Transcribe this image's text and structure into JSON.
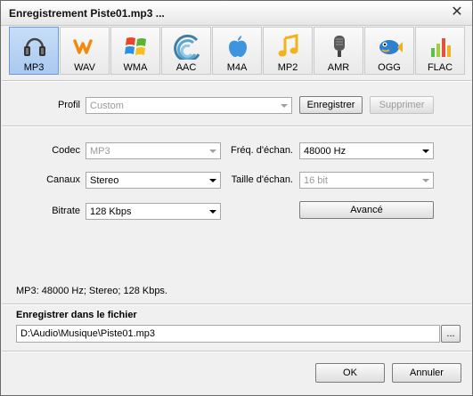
{
  "window": {
    "title": "Enregistrement Piste01.mp3 ...",
    "close_glyph": "✕"
  },
  "formats": [
    {
      "label": "MP3",
      "icon": "headphones-icon",
      "selected": true
    },
    {
      "label": "WAV",
      "icon": "wav-icon",
      "selected": false
    },
    {
      "label": "WMA",
      "icon": "windows-icon",
      "selected": false
    },
    {
      "label": "AAC",
      "icon": "aac-icon",
      "selected": false
    },
    {
      "label": "M4A",
      "icon": "apple-icon",
      "selected": false
    },
    {
      "label": "MP2",
      "icon": "music-note-icon",
      "selected": false
    },
    {
      "label": "AMR",
      "icon": "microphone-icon",
      "selected": false
    },
    {
      "label": "OGG",
      "icon": "fish-icon",
      "selected": false
    },
    {
      "label": "FLAC",
      "icon": "equalizer-icon",
      "selected": false
    }
  ],
  "profile": {
    "label": "Profil",
    "value": "Custom",
    "save_button": "Enregistrer",
    "delete_button": "Supprimer"
  },
  "settings": {
    "codec": {
      "label": "Codec",
      "value": "MP3"
    },
    "channels": {
      "label": "Canaux",
      "value": "Stereo"
    },
    "bitrate": {
      "label": "Bitrate",
      "value": "128 Kbps"
    },
    "sample_rate": {
      "label": "Fréq. d'échan.",
      "value": "48000 Hz"
    },
    "sample_size": {
      "label": "Taille d'échan.",
      "value": "16 bit"
    },
    "advanced_button": "Avancé"
  },
  "status_text": "MP3: 48000  Hz; Stereo; 128 Kbps.",
  "output": {
    "section_title": "Enregistrer dans le fichier",
    "path": "D:\\Audio\\Musique\\Piste01.mp3",
    "browse_button": "..."
  },
  "footer": {
    "ok_button": "OK",
    "cancel_button": "Annuler"
  },
  "colors": {
    "selected_format_bg": "#b8d3f3",
    "window_bg": "#f0f0f0"
  }
}
